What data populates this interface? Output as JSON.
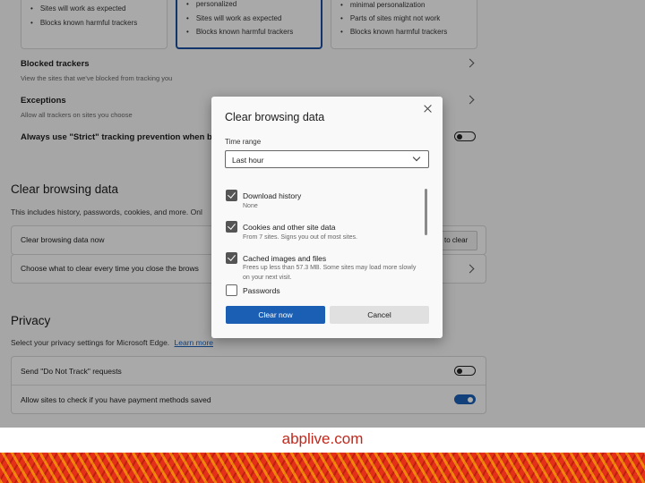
{
  "tracking_cards": [
    {
      "bullets": [
        "Sites will work as expected",
        "Blocks known harmful trackers"
      ]
    },
    {
      "bullets": [
        "personalized",
        "Sites will work as expected",
        "Blocks known harmful trackers"
      ]
    },
    {
      "bullets": [
        "minimal personalization",
        "Parts of sites might not work",
        "Blocks known harmful trackers"
      ]
    }
  ],
  "tracking_rows": {
    "blocked_title": "Blocked trackers",
    "blocked_sub": "View the sites that we've blocked from tracking you",
    "exceptions_title": "Exceptions",
    "exceptions_sub": "Allow all trackers on sites you choose",
    "strict_label": "Always use \"Strict\" tracking prevention when browsi"
  },
  "clear_section": {
    "heading": "Clear browsing data",
    "description": "This includes history, passwords, cookies, and more. Onl",
    "clear_now_label": "Clear browsing data now",
    "choose_button_label": "to clear",
    "choose_label": "Choose what to clear every time you close the brows"
  },
  "privacy_section": {
    "heading": "Privacy",
    "description": "Select your privacy settings for Microsoft Edge.",
    "learn_more": "Learn more",
    "dnt_label": "Send \"Do Not Track\" requests",
    "payment_label": "Allow sites to check if you have payment methods saved"
  },
  "dialog": {
    "title": "Clear browsing data",
    "time_range_label": "Time range",
    "time_range_value": "Last hour",
    "items": [
      {
        "title": "Download history",
        "sub": "None",
        "checked": true
      },
      {
        "title": "Cookies and other site data",
        "sub": "From 7 sites. Signs you out of most sites.",
        "checked": true
      },
      {
        "title": "Cached images and files",
        "sub": "Frees up less than 57.3 MB. Some sites may load more slowly on your next visit.",
        "checked": true
      },
      {
        "title": "Passwords",
        "sub": "",
        "checked": false
      }
    ],
    "clear_now": "Clear now",
    "cancel": "Cancel"
  },
  "footer": {
    "logo": "abplive.com"
  },
  "colors": {
    "accent": "#1a5fb4",
    "footer_red": "#c0281c"
  }
}
